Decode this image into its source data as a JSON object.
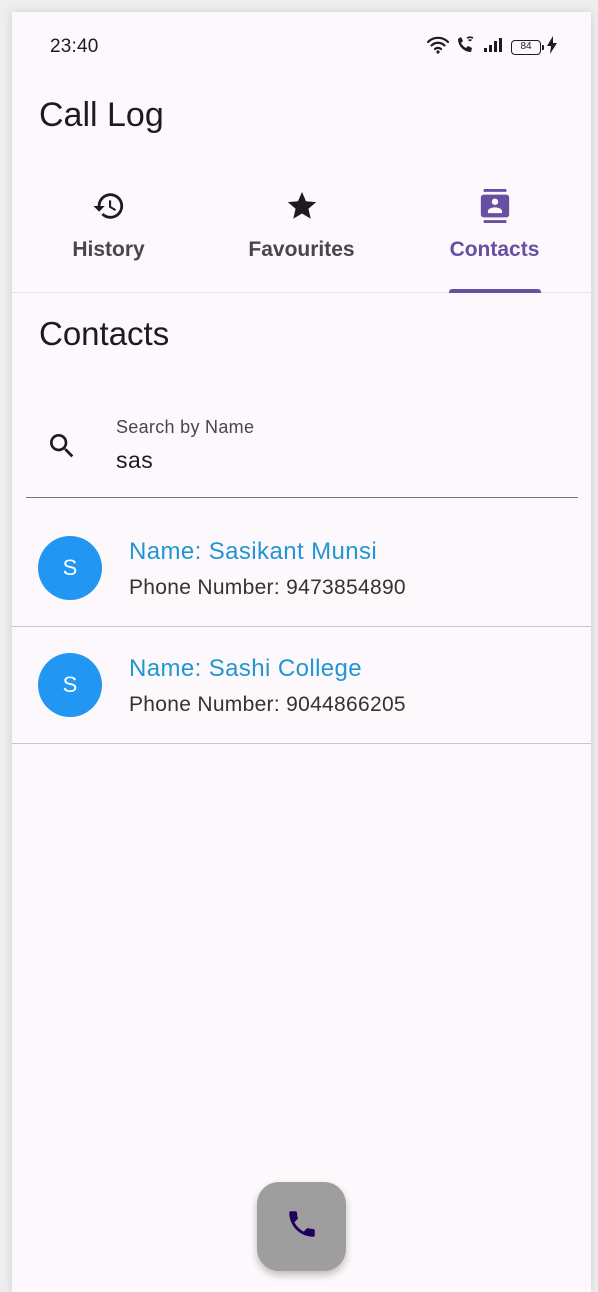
{
  "status_bar": {
    "time": "23:40",
    "battery": "84",
    "icons": [
      "wifi-icon",
      "wifi-calling-icon",
      "signal-icon",
      "battery-icon",
      "charging-icon"
    ]
  },
  "app": {
    "title": "Call Log"
  },
  "tabs": [
    {
      "label": "History",
      "icon": "history-icon",
      "active": false
    },
    {
      "label": "Favourites",
      "icon": "star-icon",
      "active": false
    },
    {
      "label": "Contacts",
      "icon": "contacts-icon",
      "active": true
    }
  ],
  "section": {
    "title": "Contacts"
  },
  "search": {
    "label": "Search by Name",
    "value": "sas"
  },
  "contacts": [
    {
      "initial": "S",
      "name": "Name: Sasikant Munsi",
      "phone": "Phone Number: 9473854890"
    },
    {
      "initial": "S",
      "name": "Name: Sashi College",
      "phone": "Phone Number: 9044866205"
    }
  ],
  "fab": {
    "icon": "phone-icon"
  },
  "colors": {
    "accent": "#6750a4",
    "avatar": "#2196f3",
    "name_text": "#2196d3",
    "fab": "#9e9e9e",
    "fab_icon": "#22005d"
  }
}
